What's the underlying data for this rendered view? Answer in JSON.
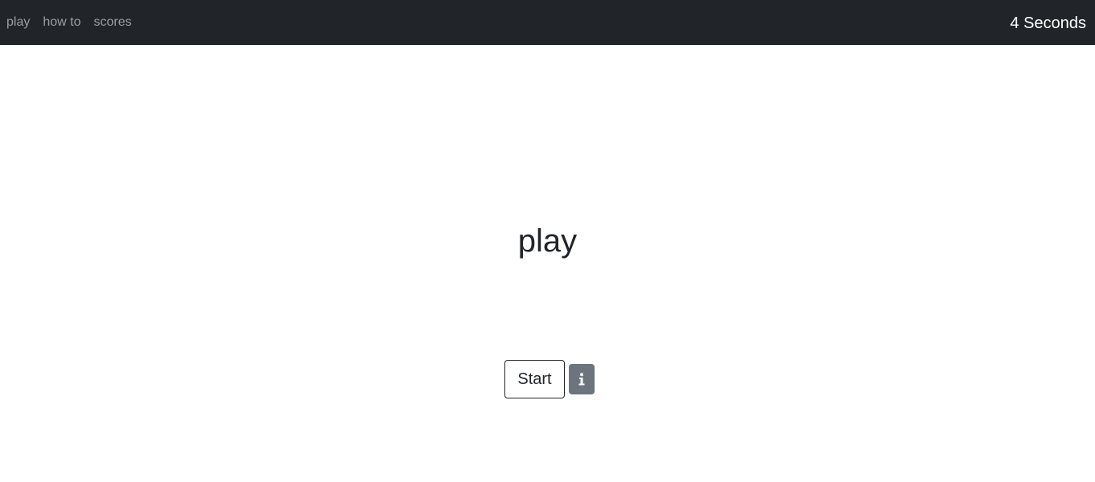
{
  "navbar": {
    "links": [
      {
        "label": "play"
      },
      {
        "label": "how to"
      },
      {
        "label": "scores"
      }
    ],
    "timer": "4 Seconds"
  },
  "main": {
    "heading": "play",
    "start_label": "Start",
    "info_icon": "info-icon"
  },
  "colors": {
    "navbar_bg": "#212529",
    "info_button_bg": "#6c757d"
  }
}
